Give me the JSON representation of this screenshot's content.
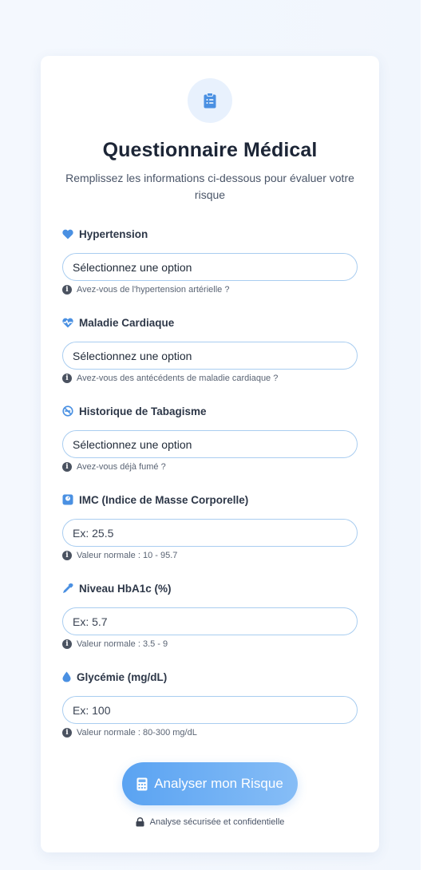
{
  "header": {
    "icon": "clipboard-list-icon",
    "title": "Questionnaire Médical",
    "subtitle": "Remplissez les informations ci-dessous pour évaluer votre risque"
  },
  "fields": [
    {
      "label": "Hypertension",
      "icon": "heart-icon",
      "type": "select",
      "value": "Sélectionnez une option",
      "hint": "Avez-vous de l'hypertension artérielle ?"
    },
    {
      "label": "Maladie Cardiaque",
      "icon": "heartbeat-icon",
      "type": "select",
      "value": "Sélectionnez une option",
      "hint": "Avez-vous des antécédents de maladie cardiaque ?"
    },
    {
      "label": "Historique de Tabagisme",
      "icon": "no-smoking-icon",
      "type": "select",
      "value": "Sélectionnez une option",
      "hint": "Avez-vous déjà fumé ?"
    },
    {
      "label": "IMC (Indice de Masse Corporelle)",
      "icon": "weight-scale-icon",
      "type": "input",
      "placeholder": "Ex: 25.5",
      "hint": "Valeur normale : 10 - 95.7"
    },
    {
      "label": "Niveau HbA1c (%)",
      "icon": "eye-dropper-icon",
      "type": "input",
      "placeholder": "Ex: 5.7",
      "hint": "Valeur normale : 3.5 - 9"
    },
    {
      "label": "Glycémie (mg/dL)",
      "icon": "droplet-icon",
      "type": "input",
      "placeholder": "Ex: 100",
      "hint": "Valeur normale : 80-300 mg/dL"
    }
  ],
  "submit": {
    "label": "Analyser mon Risque",
    "icon": "calculator-icon"
  },
  "footer": {
    "text": "Analyse sécurisée et confidentielle",
    "icon": "lock-icon"
  },
  "colors": {
    "accent": "#4a90e2",
    "button_start": "#5aa3f2",
    "button_end": "#86bdf6",
    "title": "#1c2536",
    "border": "#a9cdf0"
  }
}
